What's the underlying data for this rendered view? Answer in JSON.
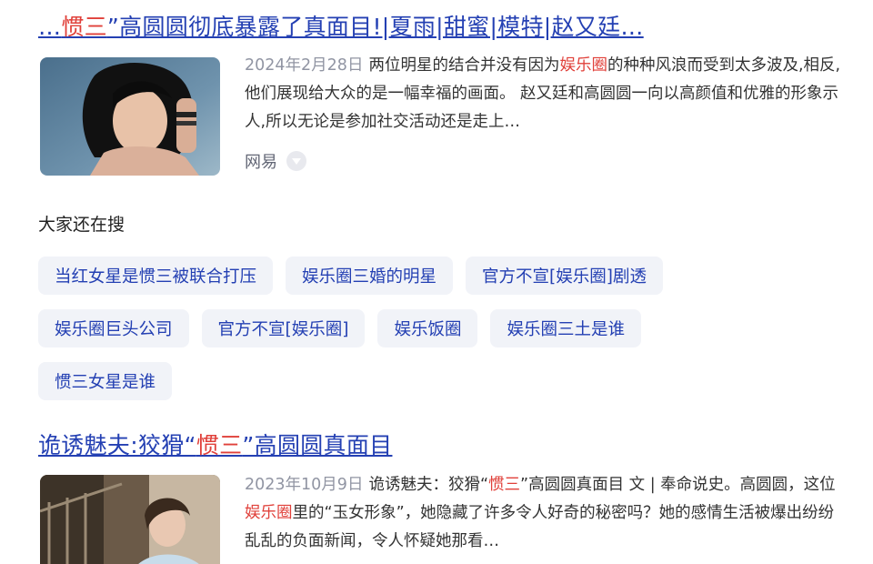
{
  "results": [
    {
      "title_parts": [
        "…",
        "惯三",
        "”高圆圆彻底暴露了真面目!|夏雨|甜蜜|模特|赵又廷…"
      ],
      "date": "2024年2月28日",
      "snippet_parts": [
        "两位明星的结合并没有因为",
        "娱乐圈",
        "的种种风浪而受到太多波及,相反,他们展现给大众的是一幅幸福的画面。 赵又廷和高圆圆一向以高颜值和优雅的形象示人,所以无论是参加社交活动还是走上…"
      ],
      "source": "网易",
      "thumbnail": "woman-portrait-photo"
    },
    {
      "title_parts": [
        "诡诱魅夫:狡猾“",
        "惯三",
        "”高圆圆真面目"
      ],
      "date": "2023年10月9日",
      "snippet_parts": [
        "诡诱魅夫：狡猾“",
        "惯三",
        "”高圆圆真面目 文 | 奉命说史。高圆圆，这位",
        "娱乐圈",
        "里的“玉女形象”，她隐藏了许多令人好奇的秘密吗？她的感情生活被爆出纷纷乱乱的负面新闻，令人怀疑她那看…"
      ],
      "thumbnail": "woman-outdoor-photo"
    }
  ],
  "related": {
    "title": "大家还在搜",
    "rows": [
      [
        "当红女星是惯三被联合打压",
        "娱乐圈三婚的明星",
        "官方不宣[娱乐圈]剧透"
      ],
      [
        "娱乐圈巨头公司",
        "官方不宣[娱乐圈]",
        "娱乐饭圈",
        "娱乐圈三土是谁"
      ],
      [
        "惯三女星是谁"
      ]
    ]
  },
  "colors": {
    "link": "#2440b3",
    "highlight": "#e0403a",
    "meta": "#9195a3",
    "chip_bg": "#f1f3f8"
  }
}
